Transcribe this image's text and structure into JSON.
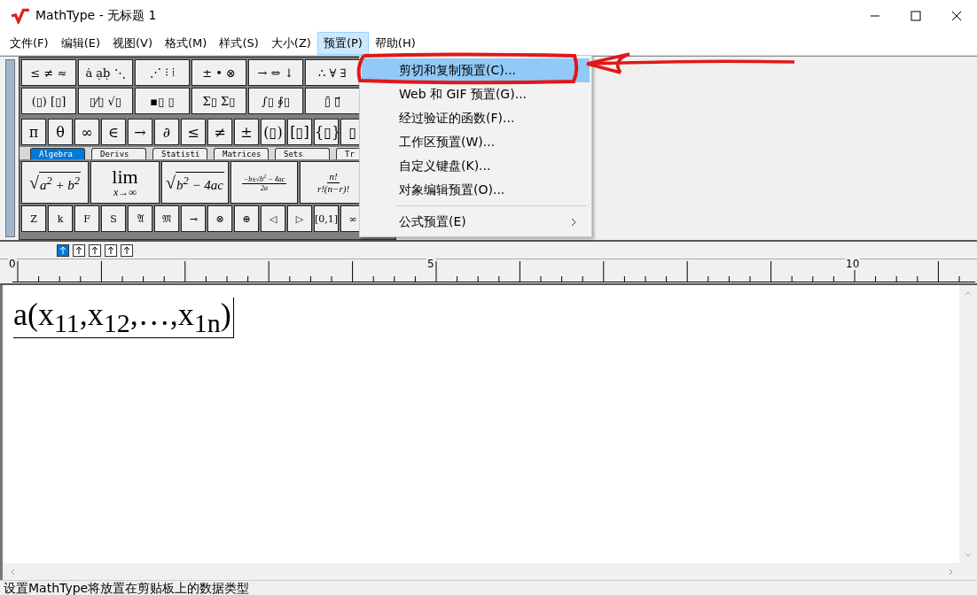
{
  "window": {
    "title": "MathType - 无标题 1"
  },
  "menu_bar": [
    {
      "label": "文件(F)",
      "selected": false
    },
    {
      "label": "编辑(E)",
      "selected": false
    },
    {
      "label": "视图(V)",
      "selected": false
    },
    {
      "label": "格式(M)",
      "selected": false
    },
    {
      "label": "样式(S)",
      "selected": false
    },
    {
      "label": "大小(Z)",
      "selected": false
    },
    {
      "label": "预置(P)",
      "selected": true
    },
    {
      "label": "帮助(H)",
      "selected": false
    }
  ],
  "palette": {
    "template_rows": [
      [
        "≤ ≠ ≈",
        "ȧ ạḅ ⋱",
        "⋰ ⁝ ⁞",
        "± • ⊗",
        "→ ⇔ ↓",
        "∴ ∀ ∃"
      ],
      [
        "(▯) [▯]",
        "▯⁄▯ √▯",
        "▪▯ ▯",
        "Σ▯ Σ▯",
        "∫▯ ∮▯",
        "▯̄ ▯⃗"
      ]
    ],
    "symbols": [
      "π",
      "θ",
      "∞",
      "∈",
      "→",
      "∂",
      "≤",
      "≠",
      "±",
      "(▯)",
      "[▯]",
      "{▯}",
      "▯"
    ],
    "tabs": [
      {
        "label": "Algebra",
        "selected": true
      },
      {
        "label": "Derivs",
        "selected": false
      },
      {
        "label": "Statisti",
        "selected": false
      },
      {
        "label": "Matrices",
        "selected": false
      },
      {
        "label": "Sets",
        "selected": false
      },
      {
        "label": "Tr",
        "selected": false
      }
    ],
    "templates": [
      {
        "kind": "radical",
        "sign": "√",
        "body": "a$^{2}$ + b$^{2}$"
      },
      {
        "kind": "limit",
        "top": "lim",
        "bottom": "x→∞"
      },
      {
        "kind": "radical",
        "sign": "√",
        "body": "b$^{2}$ − 4ac"
      },
      {
        "kind": "fraction",
        "top": "−b±√b$^{2}$ − 4ac",
        "bottom": "2a"
      },
      {
        "kind": "fraction",
        "top": "n!",
        "bottom": "r!(n−r)!"
      }
    ],
    "bottom_row": [
      "Z",
      "k",
      "F",
      "S",
      "𝔄",
      "𝔐",
      "⊸",
      "⊗",
      "⊕",
      "◁",
      "▷",
      "[0,1]",
      "∞"
    ]
  },
  "size_buttons": [
    {
      "selected": true
    },
    {
      "selected": false
    },
    {
      "selected": false
    },
    {
      "selected": false
    },
    {
      "selected": false
    }
  ],
  "ruler": {
    "labels": [
      "0",
      "5",
      "10"
    ]
  },
  "document": {
    "equation": "a(x$_{11}$,x$_{12}$,…,x$_{1n}$)"
  },
  "dropdown": {
    "items": [
      {
        "label": "剪切和复制预置(C)...",
        "selected": true,
        "submenu": false
      },
      {
        "label": "Web 和 GIF 预置(G)...",
        "selected": false,
        "submenu": false
      },
      {
        "label": "经过验证的函数(F)...",
        "selected": false,
        "submenu": false
      },
      {
        "label": "工作区预置(W)...",
        "selected": false,
        "submenu": false
      },
      {
        "label": "自定义键盘(K)...",
        "selected": false,
        "submenu": false
      },
      {
        "label": "对象编辑预置(O)...",
        "selected": false,
        "submenu": false
      },
      {
        "label": "公式预置(E)",
        "selected": false,
        "submenu": true
      }
    ]
  },
  "status_bar": "设置MathType将放置在剪贴板上的数据类型"
}
